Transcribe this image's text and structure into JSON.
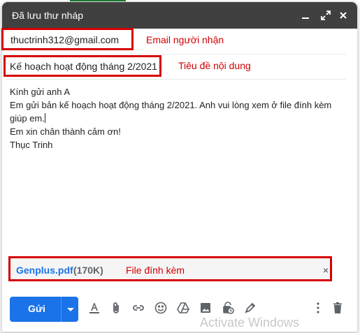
{
  "compose": {
    "title": "Đã lưu thư nháp",
    "to": "thuctrinh312@gmail.com",
    "to_note": "Email người nhận",
    "subject": "Kế hoạch hoạt động tháng 2/2021",
    "subject_note": "Tiêu đề nội dung",
    "body_lines": [
      "Kính gửi anh A",
      "Em gửi bản kế hoạch hoạt động tháng 2/2021. Anh vui lòng xem ở file đính kèm",
      "giúp em.",
      "Em xin chân thành cảm ơn!",
      "Thục Trinh"
    ],
    "attachment": {
      "name": "Genplus.pdf",
      "size": "(170K)",
      "note": "File đính kèm",
      "remove": "×"
    },
    "send_label": "Gửi"
  },
  "watermark": "Activate Windows",
  "icons": [
    "minimize-icon",
    "expand-icon",
    "close-icon",
    "format-text-icon",
    "attach-icon",
    "link-icon",
    "emoji-icon",
    "drive-icon",
    "photo-icon",
    "confidential-icon",
    "signature-icon",
    "more-icon",
    "trash-icon"
  ]
}
